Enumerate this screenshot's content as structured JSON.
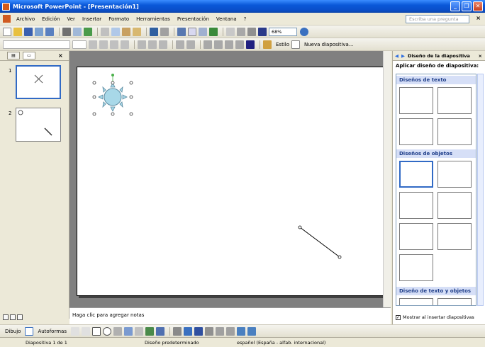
{
  "window": {
    "title": "Microsoft PowerPoint - [Presentación1]"
  },
  "menu": {
    "items": [
      "Archivo",
      "Edición",
      "Ver",
      "Insertar",
      "Formato",
      "Herramientas",
      "Presentación",
      "Ventana",
      "?"
    ],
    "help_placeholder": "Escriba una pregunta"
  },
  "toolbar": {
    "zoom": "68%",
    "design_label": "Estilo",
    "new_slide_label": "Nueva diapositiva..."
  },
  "slides_pane": {
    "slide_numbers": [
      "1",
      "2"
    ]
  },
  "notes": {
    "placeholder": "Haga clic para agregar notas"
  },
  "task_pane": {
    "title": "Diseño de la diapositiva",
    "subtitle": "Aplicar diseño de diapositiva:",
    "sections": [
      "Diseños de texto",
      "Diseños de objetos",
      "Diseño de texto y objetos"
    ],
    "show_on_insert_label": "Mostrar al insertar diapositivas",
    "show_on_insert_checked": true
  },
  "drawing_toolbar": {
    "draw_label": "Dibujo",
    "autoshapes_label": "Autoformas"
  },
  "status": {
    "slide": "Diapositiva 1 de 1",
    "design": "Diseño predeterminado",
    "language": "español (España - alfab. internacional)"
  },
  "colors": {
    "accent": "#316ac5",
    "title_bar": "#0a58d8",
    "section": "#d6dff7"
  }
}
